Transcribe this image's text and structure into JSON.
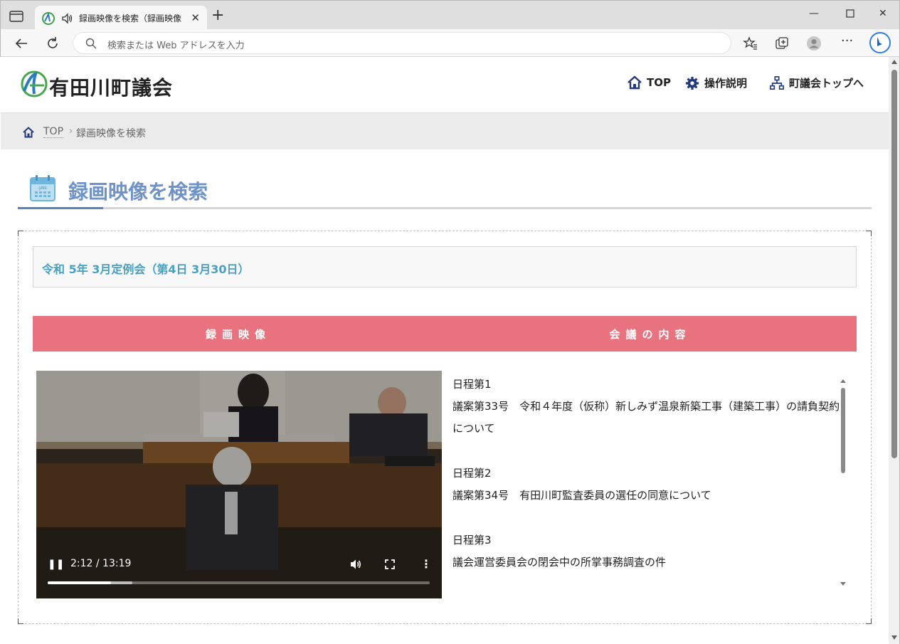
{
  "browser": {
    "tab_title": "録画映像を検索（録画映像",
    "address_placeholder": "検索または Web アドレスを入力"
  },
  "site": {
    "name": "有田川町議会",
    "nav": [
      {
        "label": "TOP"
      },
      {
        "label": "操作説明"
      },
      {
        "label": "町議会トップへ"
      }
    ]
  },
  "breadcrumb": {
    "top": "TOP",
    "separator": "›",
    "current": "録画映像を検索"
  },
  "page": {
    "title": "録画映像を検索",
    "session_title": "令和 5年 3月定例会（第4日 3月30日）",
    "col_video": "録画映像",
    "col_content": "会議の内容"
  },
  "video": {
    "time": "2:12 / 13:19",
    "progress_fraction": 0.166,
    "buffered_fraction": 0.222
  },
  "agenda": [
    {
      "label": "日程第1",
      "text": "議案第33号　令和４年度（仮称）新しみず温泉新築工事（建築工事）の請負契約について"
    },
    {
      "label": "日程第2",
      "text": "議案第34号　有田川町監査委員の選任の同意について"
    },
    {
      "label": "日程第3",
      "text": "議会運営委員会の閉会中の所掌事務調査の件"
    }
  ],
  "colors": {
    "accent_blue": "#5b7fc7",
    "title_blue": "#6f93c9",
    "session_blue": "#4aa0c2",
    "header_pink": "#e8737f"
  }
}
